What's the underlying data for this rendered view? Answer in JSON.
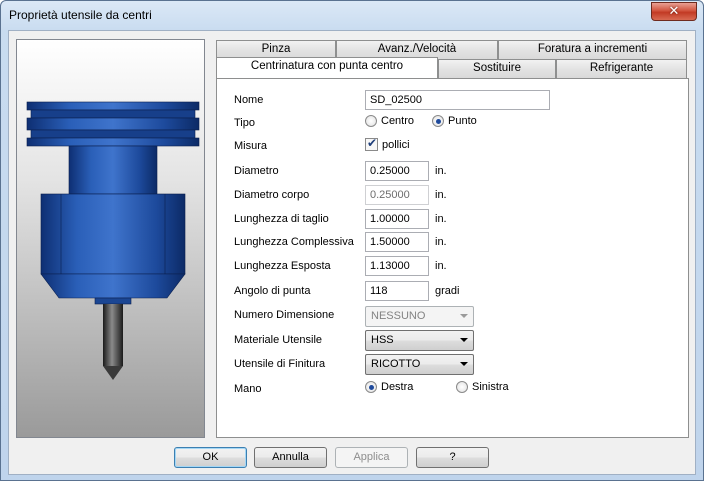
{
  "window": {
    "title": "Proprietà utensile da centri"
  },
  "tabs": {
    "row_back": [
      "Pinza",
      "Avanz./Velocità",
      "Foratura a incrementi"
    ],
    "row_front": [
      "Centrinatura con punta centro",
      "Sostituire",
      "Refrigerante"
    ],
    "active": "Centrinatura con punta centro"
  },
  "form": {
    "nome": {
      "label": "Nome",
      "value": "SD_02500"
    },
    "tipo": {
      "label": "Tipo",
      "options": [
        "Centro",
        "Punto"
      ],
      "selected": "Punto"
    },
    "misura": {
      "label": "Misura",
      "checkbox_label": "pollici",
      "checked": true
    },
    "diametro": {
      "label": "Diametro",
      "value": "0.25000",
      "unit": "in."
    },
    "diametro_corpo": {
      "label": "Diametro corpo",
      "value": "0.25000",
      "unit": "in."
    },
    "lunghezza_taglio": {
      "label": "Lunghezza di taglio",
      "value": "1.00000",
      "unit": "in."
    },
    "lunghezza_complessiva": {
      "label": "Lunghezza Complessiva",
      "value": "1.50000",
      "unit": "in."
    },
    "lunghezza_esposta": {
      "label": "Lunghezza Esposta",
      "value": "1.13000",
      "unit": "in."
    },
    "angolo_punta": {
      "label": "Angolo di punta",
      "value": "118",
      "unit": "gradi"
    },
    "numero_dimensione": {
      "label": "Numero Dimensione",
      "value": "NESSUNO"
    },
    "materiale": {
      "label": "Materiale Utensile",
      "value": "HSS"
    },
    "finitura": {
      "label": "Utensile di Finitura",
      "value": "RICOTTO"
    },
    "mano": {
      "label": "Mano",
      "options": [
        "Destra",
        "Sinistra"
      ],
      "selected": "Destra"
    }
  },
  "buttons": {
    "ok": "OK",
    "annulla": "Annulla",
    "applica": "Applica",
    "help": "?"
  },
  "icons": {
    "close": "close-icon",
    "tool_preview": "tool-holder-image"
  },
  "colors": {
    "tool_blue": "#1f4fa3",
    "accent": "#3c7fb1"
  }
}
